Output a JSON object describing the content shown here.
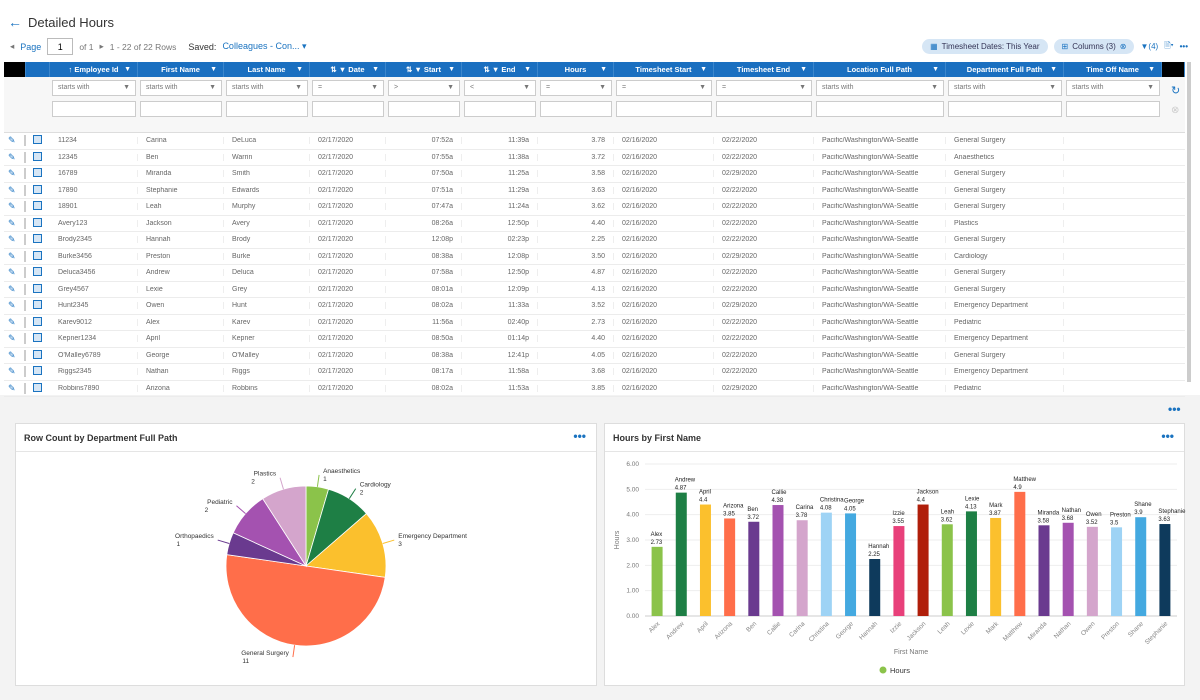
{
  "page": {
    "title": "Detailed Hours",
    "back_icon": "arrow-left-icon"
  },
  "pager": {
    "page_label": "Page",
    "page_value": "1",
    "of_label": "of 1",
    "rows_label": "1 - 22 of 22 Rows",
    "saved_label": "Saved:",
    "saved_value": "Colleagues - Con..."
  },
  "toolbar": {
    "timesheet_chip": "Timesheet Dates: This Year",
    "columns_chip": "Columns (3)",
    "filter_count": "(4)",
    "more": "•••"
  },
  "grid": {
    "columns": [
      {
        "label": "Employee Id",
        "w": 88,
        "icon": "↑ "
      },
      {
        "label": "First Name",
        "w": 86,
        "icon": ""
      },
      {
        "label": "Last Name",
        "w": 86,
        "icon": ""
      },
      {
        "label": "Date",
        "w": 76,
        "icon": "⇅ ▼ "
      },
      {
        "label": "Start",
        "w": 76,
        "icon": "⇅ ▼ "
      },
      {
        "label": "End",
        "w": 76,
        "icon": "⇅ ▼ "
      },
      {
        "label": "Hours",
        "w": 76,
        "icon": ""
      },
      {
        "label": "Timesheet Start",
        "w": 100,
        "icon": ""
      },
      {
        "label": "Timesheet End",
        "w": 100,
        "icon": ""
      },
      {
        "label": "Location Full Path",
        "w": 132,
        "icon": ""
      },
      {
        "label": "Department Full Path",
        "w": 118,
        "icon": ""
      },
      {
        "label": "Time Off Name",
        "w": 98,
        "icon": ""
      }
    ],
    "filters": [
      "starts with",
      "starts with",
      "starts with",
      "=",
      ">",
      "<",
      "=",
      "=",
      "=",
      "starts with",
      "starts with",
      "starts with"
    ],
    "rows": [
      [
        "11234",
        "Carina",
        "DeLuca",
        "02/17/2020",
        "07:52a",
        "11:39a",
        "3.78",
        "02/16/2020",
        "02/22/2020",
        "Pacific/Washington/WA-Seattle",
        "General Surgery",
        ""
      ],
      [
        "12345",
        "Ben",
        "Warrin",
        "02/17/2020",
        "07:55a",
        "11:38a",
        "3.72",
        "02/16/2020",
        "02/22/2020",
        "Pacific/Washington/WA-Seattle",
        "Anaesthetics",
        ""
      ],
      [
        "16789",
        "Miranda",
        "Smith",
        "02/17/2020",
        "07:50a",
        "11:25a",
        "3.58",
        "02/16/2020",
        "02/29/2020",
        "Pacific/Washington/WA-Seattle",
        "General Surgery",
        ""
      ],
      [
        "17890",
        "Stephanie",
        "Edwards",
        "02/17/2020",
        "07:51a",
        "11:29a",
        "3.63",
        "02/16/2020",
        "02/22/2020",
        "Pacific/Washington/WA-Seattle",
        "General Surgery",
        ""
      ],
      [
        "18901",
        "Leah",
        "Murphy",
        "02/17/2020",
        "07:47a",
        "11:24a",
        "3.62",
        "02/16/2020",
        "02/22/2020",
        "Pacific/Washington/WA-Seattle",
        "General Surgery",
        ""
      ],
      [
        "Avery123",
        "Jackson",
        "Avery",
        "02/17/2020",
        "08:26a",
        "12:50p",
        "4.40",
        "02/16/2020",
        "02/22/2020",
        "Pacific/Washington/WA-Seattle",
        "Plastics",
        ""
      ],
      [
        "Brody2345",
        "Hannah",
        "Brody",
        "02/17/2020",
        "12:08p",
        "02:23p",
        "2.25",
        "02/16/2020",
        "02/22/2020",
        "Pacific/Washington/WA-Seattle",
        "General Surgery",
        ""
      ],
      [
        "Burke3456",
        "Preston",
        "Burke",
        "02/17/2020",
        "08:38a",
        "12:08p",
        "3.50",
        "02/16/2020",
        "02/29/2020",
        "Pacific/Washington/WA-Seattle",
        "Cardiology",
        ""
      ],
      [
        "Deluca3456",
        "Andrew",
        "Deluca",
        "02/17/2020",
        "07:58a",
        "12:50p",
        "4.87",
        "02/16/2020",
        "02/22/2020",
        "Pacific/Washington/WA-Seattle",
        "General Surgery",
        ""
      ],
      [
        "Grey4567",
        "Lexie",
        "Grey",
        "02/17/2020",
        "08:01a",
        "12:09p",
        "4.13",
        "02/16/2020",
        "02/22/2020",
        "Pacific/Washington/WA-Seattle",
        "General Surgery",
        ""
      ],
      [
        "Hunt2345",
        "Owen",
        "Hunt",
        "02/17/2020",
        "08:02a",
        "11:33a",
        "3.52",
        "02/16/2020",
        "02/29/2020",
        "Pacific/Washington/WA-Seattle",
        "Emergency Department",
        ""
      ],
      [
        "Karev9012",
        "Alex",
        "Karev",
        "02/17/2020",
        "11:56a",
        "02:40p",
        "2.73",
        "02/16/2020",
        "02/22/2020",
        "Pacific/Washington/WA-Seattle",
        "Pediatric",
        ""
      ],
      [
        "Kepner1234",
        "April",
        "Kepner",
        "02/17/2020",
        "08:50a",
        "01:14p",
        "4.40",
        "02/16/2020",
        "02/22/2020",
        "Pacific/Washington/WA-Seattle",
        "Emergency Department",
        ""
      ],
      [
        "O'Malley6789",
        "George",
        "O'Malley",
        "02/17/2020",
        "08:38a",
        "12:41p",
        "4.05",
        "02/16/2020",
        "02/22/2020",
        "Pacific/Washington/WA-Seattle",
        "General Surgery",
        ""
      ],
      [
        "Riggs2345",
        "Nathan",
        "Riggs",
        "02/17/2020",
        "08:17a",
        "11:58a",
        "3.68",
        "02/16/2020",
        "02/22/2020",
        "Pacific/Washington/WA-Seattle",
        "Emergency Department",
        ""
      ],
      [
        "Robbins7890",
        "Arizona",
        "Robbins",
        "02/17/2020",
        "08:02a",
        "11:53a",
        "3.85",
        "02/16/2020",
        "02/29/2020",
        "Pacific/Washington/WA-Seattle",
        "Pediatric",
        ""
      ]
    ]
  },
  "section_more": "•••",
  "chart_data": [
    {
      "type": "pie",
      "title": "Row Count by Department Full Path",
      "slices": [
        {
          "label": "Anaesthetics",
          "value": 1,
          "color": "#8bc34a"
        },
        {
          "label": "Cardiology",
          "value": 2,
          "color": "#1e7f45"
        },
        {
          "label": "Emergency Department",
          "value": 3,
          "color": "#fbc02d"
        },
        {
          "label": "General Surgery",
          "value": 11,
          "color": "#ff6e4a"
        },
        {
          "label": "Orthopaedics",
          "value": 1,
          "color": "#6a3a8f"
        },
        {
          "label": "Pediatric",
          "value": 2,
          "color": "#a452b0"
        },
        {
          "label": "Plastics",
          "value": 2,
          "color": "#d4a5cc"
        }
      ]
    },
    {
      "type": "bar",
      "title": "Hours by First Name",
      "xlabel": "First Name",
      "ylabel": "Hours",
      "ylim": [
        0,
        6
      ],
      "yticks": [
        "0.00",
        "1.00",
        "2.00",
        "3.00",
        "4.00",
        "5.00",
        "6.00"
      ],
      "legend": "Hours",
      "legend_color": "#8bc34a",
      "legend_position": "bottom",
      "grid": true,
      "categories": [
        "Alex",
        "Andrew",
        "April",
        "Arizona",
        "Ben",
        "Callie",
        "Carina",
        "Christina",
        "George",
        "Hannah",
        "Izzie",
        "Jackson",
        "Leah",
        "Lexie",
        "Mark",
        "Matthew",
        "Miranda",
        "Nathan",
        "Owen",
        "Preston",
        "Shane",
        "Stephanie"
      ],
      "values": [
        2.73,
        4.87,
        4.4,
        3.85,
        3.72,
        4.38,
        3.78,
        4.08,
        4.05,
        2.25,
        3.55,
        4.4,
        3.62,
        4.13,
        3.87,
        4.9,
        3.58,
        3.68,
        3.52,
        3.5,
        3.9,
        3.63
      ],
      "labels": [
        "2.73",
        "4.87",
        "4.4",
        "3.85",
        "3.72",
        "4.38",
        "3.78",
        "4.08",
        "4.05",
        "2.25",
        "3.55",
        "4.4",
        "3.62",
        "4.13",
        "3.87",
        "4.9",
        "3.58",
        "3.68",
        "3.52",
        "3.5",
        "3.9",
        "3.63"
      ],
      "colors": [
        "#8bc34a",
        "#1e7f45",
        "#fbc02d",
        "#ff6e4a",
        "#6a3a8f",
        "#a452b0",
        "#d4a5cc",
        "#9ed3f5",
        "#44a9e0",
        "#0e3a5c",
        "#e8407a",
        "#b01e0a",
        "#8bc34a",
        "#1e7f45",
        "#fbc02d",
        "#ff6e4a",
        "#6a3a8f",
        "#a452b0",
        "#d4a5cc",
        "#9ed3f5",
        "#44a9e0",
        "#0e3a5c"
      ]
    }
  ]
}
